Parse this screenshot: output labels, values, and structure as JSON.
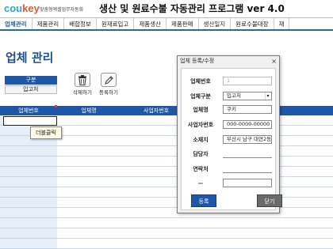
{
  "header": {
    "logo_cou": "cou",
    "logo_key": "key",
    "logo_sub": "맞춤형엑셀업무자동화",
    "title": "생산 및 원료수불 자동관리 프로그램 ver 4.0"
  },
  "menu": [
    {
      "label": "업체관리",
      "active": true
    },
    {
      "label": "제품관리",
      "active": false
    },
    {
      "label": "배합정보",
      "active": false
    },
    {
      "label": "원재료입고",
      "active": false
    },
    {
      "label": "제품생산",
      "active": false
    },
    {
      "label": "제품판매",
      "active": false
    },
    {
      "label": "생산일지",
      "active": false
    },
    {
      "label": "원료수불대장",
      "active": false
    },
    {
      "label": "재",
      "active": false
    }
  ],
  "page_title": "업체 관리",
  "filter": {
    "label": "구분",
    "value": "입고처"
  },
  "toolbar": {
    "delete_label": "삭제하기",
    "register_label": "등록하기"
  },
  "grid": {
    "columns": [
      "업체번호",
      "업체명",
      "사업자번호"
    ],
    "selected_cell_value": "",
    "tooltip": "더블클릭"
  },
  "dialog": {
    "title": "업체 등록/수정",
    "close_symbol": "×",
    "fields": {
      "company_no_label": "업체번호",
      "company_no_value": "1",
      "category_label": "업체구분",
      "category_value": "입고처",
      "name_label": "업체명",
      "name_value": "쿠키",
      "biz_no_label": "사업자번호",
      "biz_no_value": "000-0000-00000",
      "address_label": "소재지",
      "address_value": "부산시 남구 대연2동",
      "manager_label": "담당자",
      "manager_value": "",
      "contact_label": "연락처",
      "contact_value": "",
      "etc_label": "--",
      "etc_value": ""
    },
    "register_button": "등록",
    "close_button": "닫기"
  },
  "colors": {
    "accent": "#1e56a8",
    "logo_blue": "#2aa6d9",
    "logo_orange": "#e65a2a"
  }
}
